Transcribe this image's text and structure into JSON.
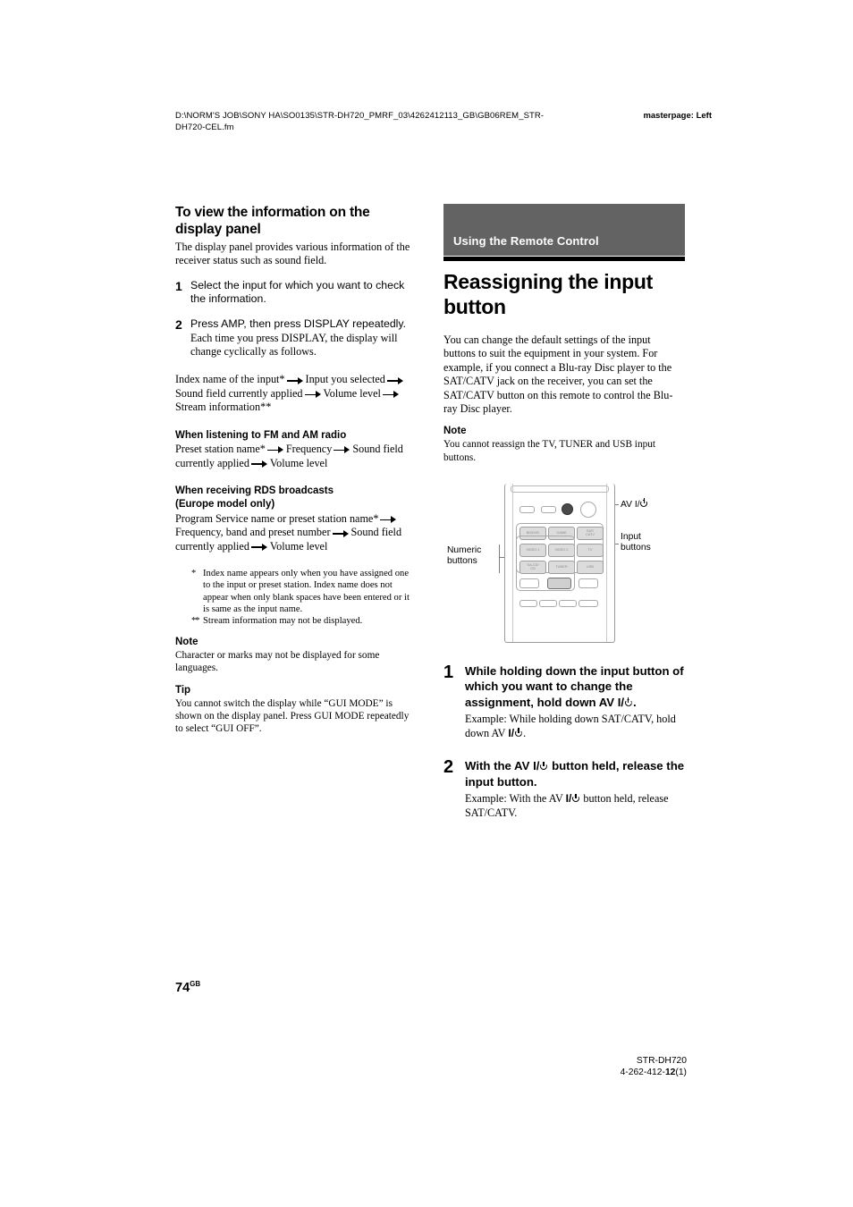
{
  "header": {
    "path": "D:\\NORM'S JOB\\SONY HA\\SO0135\\STR-DH720_PMRF_03\\4262412113_GB\\GB06REM_STR-DH720-CEL.fm",
    "masterpage": "masterpage: Left"
  },
  "left_column": {
    "heading": "To view the information on the display panel",
    "intro": "The display panel provides various information of the receiver status such as sound field.",
    "steps": [
      {
        "num": "1",
        "title": "Select the input for which you want to check the information.",
        "body": ""
      },
      {
        "num": "2",
        "title": "Press AMP, then press DISPLAY repeatedly.",
        "body": "Each time you press DISPLAY, the display will change cyclically as follows."
      }
    ],
    "cycle_seq": {
      "p1": "Index name of the input*",
      "p2": "Input you selected",
      "p3": "Sound field currently applied",
      "p4": "Volume level",
      "p5": "Stream information**"
    },
    "fm_am": {
      "heading": "When listening to FM and AM radio",
      "p1": "Preset station name*",
      "p2": "Frequency",
      "p3": "Sound field currently applied",
      "p4": "Volume level"
    },
    "rds": {
      "heading_line1": "When receiving RDS broadcasts",
      "heading_line2": "(Europe model only)",
      "p1": "Program Service name or preset station name*",
      "p2": "Frequency, band and preset number",
      "p3": "Sound field currently applied",
      "p4": "Volume level"
    },
    "footnotes": [
      {
        "mark": "*",
        "text": "Index name appears only when you have assigned one to the input or preset station. Index name does not appear when only blank spaces have been entered or it is same as the input name."
      },
      {
        "mark": "**",
        "text": "Stream information may not be displayed."
      }
    ],
    "note": {
      "label": "Note",
      "text": "Character or marks may not be displayed for some languages."
    },
    "tip": {
      "label": "Tip",
      "text": "You cannot switch the display while “GUI MODE” is shown on the display panel. Press GUI MODE repeatedly to select “GUI OFF”."
    }
  },
  "right_column": {
    "banner": "Using the Remote Control",
    "chapter_title": "Reassigning the input button",
    "intro": "You can change the default settings of the input buttons to suit the equipment in your system. For example, if you connect a Blu-ray Disc player to the SAT/CATV jack on the receiver, you can set the SAT/CATV button on this remote to control the Blu-ray Disc player.",
    "note": {
      "label": "Note",
      "text": "You cannot reassign the TV, TUNER and USB input buttons."
    },
    "figure": {
      "callout_av": "AV I/",
      "callout_input_line1": "Input",
      "callout_input_line2": "buttons",
      "callout_numeric_line1": "Numeric",
      "callout_numeric_line2": "buttons",
      "input_buttons": [
        "BD/DVD",
        "GAME",
        "SAT/\nCATV",
        "VIDEO 1",
        "VIDEO 2",
        "TV",
        "SA-CD/\nCD",
        "TUNER",
        "USB"
      ]
    },
    "steps": [
      {
        "num": "1",
        "title_a": "While holding down the input button of which you want to change the assignment, hold down AV I/",
        "title_b": ".",
        "body_a": "Example: While holding down SAT/CATV, hold down AV ",
        "body_b": "I/",
        "body_c": "."
      },
      {
        "num": "2",
        "title_a": "With the AV I/",
        "title_b": " button held, release the input button.",
        "body_a": "Example: With the AV ",
        "body_b": "I/",
        "body_c": " button held, release SAT/CATV."
      }
    ]
  },
  "page_number": {
    "num": "74",
    "sup": "GB"
  },
  "footer": {
    "model": "STR-DH720",
    "code_prefix": "4-262-412-",
    "code_bold": "12",
    "code_suffix": "(1)"
  },
  "colors": {
    "banner_gray": "#636363",
    "rule_black": "#000000",
    "button_gray": "#dcdcdc",
    "outline_gray": "#a9a9a9"
  }
}
